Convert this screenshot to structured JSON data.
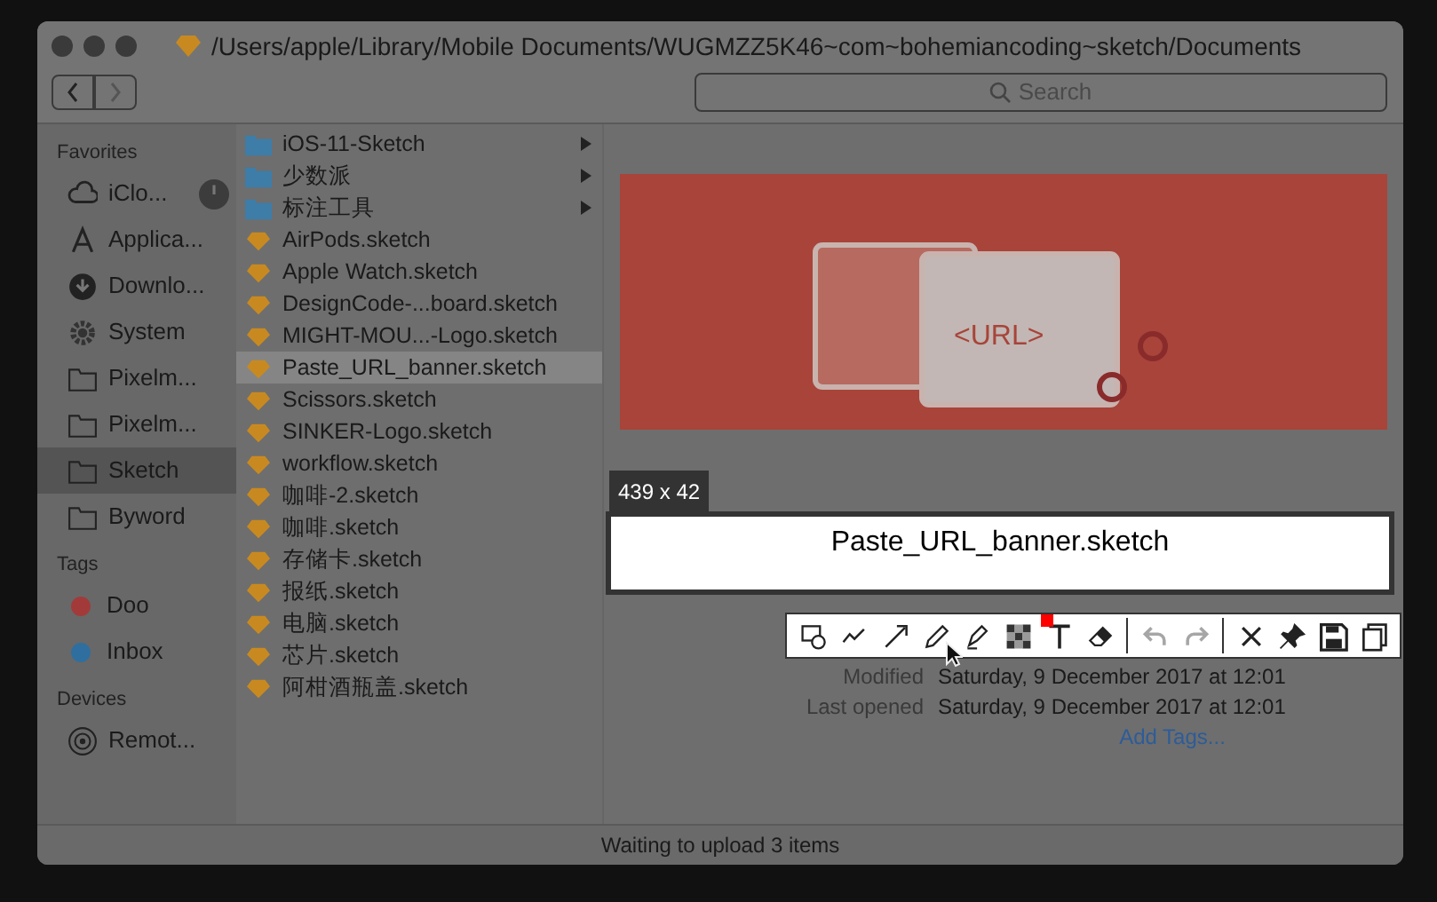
{
  "window": {
    "title": "/Users/apple/Library/Mobile Documents/WUGMZZ5K46~com~bohemiancoding~sketch/Documents",
    "nav": [
      {
        "kind": "back",
        "disabled": false
      },
      {
        "kind": "forward",
        "disabled": true
      }
    ]
  },
  "search": {
    "placeholder": "Search"
  },
  "sidebar": {
    "sections": [
      {
        "title": "Favorites",
        "items": [
          {
            "kind": "cloud",
            "label": "iClo...",
            "selected": false
          },
          {
            "kind": "apps",
            "label": "Applica...",
            "selected": false
          },
          {
            "kind": "download",
            "label": "Downlo...",
            "selected": false
          },
          {
            "kind": "gear",
            "label": "System",
            "selected": false
          },
          {
            "kind": "folder",
            "label": "Pixelm...",
            "selected": false
          },
          {
            "kind": "folder",
            "label": "Pixelm...",
            "selected": false
          },
          {
            "kind": "folder",
            "label": "Sketch",
            "selected": true
          },
          {
            "kind": "folder",
            "label": "Byword",
            "selected": false
          }
        ]
      },
      {
        "title": "Tags",
        "items": [
          {
            "kind": "tag",
            "label": "Doo",
            "selected": false,
            "color": "#a33a3a"
          },
          {
            "kind": "tag",
            "label": "Inbox",
            "selected": false,
            "color": "#2f6f9f"
          }
        ]
      },
      {
        "title": "Devices",
        "items": [
          {
            "kind": "disc",
            "label": "Remot...",
            "selected": false
          }
        ]
      }
    ]
  },
  "files": [
    {
      "kind": "folder",
      "name": "iOS-11-Sketch",
      "selected": false
    },
    {
      "kind": "folder",
      "name": "少数派",
      "selected": false
    },
    {
      "kind": "folder",
      "name": "标注工具",
      "selected": false
    },
    {
      "kind": "sketch",
      "name": "AirPods.sketch",
      "selected": false
    },
    {
      "kind": "sketch",
      "name": "Apple Watch.sketch",
      "selected": false
    },
    {
      "kind": "sketch",
      "name": "DesignCode-...board.sketch",
      "selected": false
    },
    {
      "kind": "sketch",
      "name": "MIGHT-MOU...-Logo.sketch",
      "selected": false
    },
    {
      "kind": "sketch",
      "name": "Paste_URL_banner.sketch",
      "selected": true
    },
    {
      "kind": "sketch",
      "name": "Scissors.sketch",
      "selected": false
    },
    {
      "kind": "sketch",
      "name": "SINKER-Logo.sketch",
      "selected": false
    },
    {
      "kind": "sketch",
      "name": "workflow.sketch",
      "selected": false
    },
    {
      "kind": "sketch",
      "name": "咖啡-2.sketch",
      "selected": false
    },
    {
      "kind": "sketch",
      "name": "咖啡.sketch",
      "selected": false
    },
    {
      "kind": "sketch",
      "name": "存储卡.sketch",
      "selected": false
    },
    {
      "kind": "sketch",
      "name": "报纸.sketch",
      "selected": false
    },
    {
      "kind": "sketch",
      "name": "电脑.sketch",
      "selected": false
    },
    {
      "kind": "sketch",
      "name": "芯片.sketch",
      "selected": false
    },
    {
      "kind": "sketch",
      "name": "阿柑酒瓶盖.sketch",
      "selected": false
    }
  ],
  "preview": {
    "image_text": "<URL>",
    "info": [
      {
        "label": "Modified",
        "value": "Saturday, 9 December 2017 at 12:01"
      },
      {
        "label": "Last opened",
        "value": "Saturday, 9 December 2017 at 12:01"
      }
    ],
    "add_tags": "Add Tags..."
  },
  "status_bar": "Waiting to upload 3 items",
  "capture": {
    "size": "439 x 42",
    "text": "Paste_URL_banner.sketch",
    "tools": [
      {
        "kind": "shape",
        "disabled": false
      },
      {
        "kind": "line",
        "disabled": false
      },
      {
        "kind": "arrow",
        "disabled": false
      },
      {
        "kind": "pencil",
        "disabled": false
      },
      {
        "kind": "highlighter",
        "disabled": false
      },
      {
        "kind": "mosaic",
        "disabled": false
      },
      {
        "kind": "text",
        "disabled": false
      },
      {
        "kind": "eraser",
        "disabled": false
      },
      {
        "kind": "sep"
      },
      {
        "kind": "undo",
        "disabled": true
      },
      {
        "kind": "redo",
        "disabled": true
      },
      {
        "kind": "sep"
      },
      {
        "kind": "close",
        "disabled": false
      },
      {
        "kind": "pin",
        "disabled": false
      },
      {
        "kind": "save",
        "disabled": false
      },
      {
        "kind": "copy",
        "disabled": false
      }
    ],
    "color": "#ff0000"
  }
}
